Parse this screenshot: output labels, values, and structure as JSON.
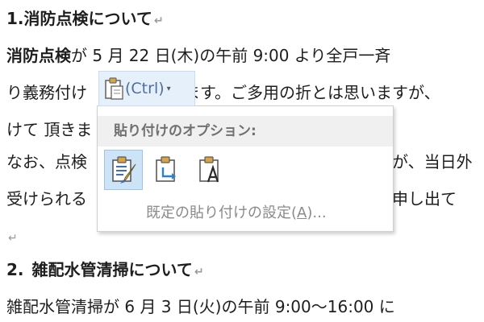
{
  "document": {
    "line1": "1.消防点検について",
    "line2_bold": "消防点検",
    "line2_rest": "が 5 月 22 日(木)の午前 9:00 より全戸一斉",
    "line3_a": "り義務付け",
    "line3_b": "ます。ご多用の折とは思いますが、",
    "line4": "けて 頂きま",
    "line5_a": "なお、点検",
    "line5_b": "が、当日外",
    "line6_a": "受けられる",
    "line6_b": "申し出て",
    "line8_num": "2.",
    "line8_head": "雑配水管清掃について",
    "line9": "雑配水管清掃が 6 月 3 日(火)の午前 9:00〜16:00 に",
    "paragraph_mark": "↵"
  },
  "smart_tag": {
    "label": "(Ctrl)",
    "icon": "clipboard-icon",
    "arrow": "▾"
  },
  "paste_menu": {
    "title": "貼り付けのオプション:",
    "options": [
      {
        "icon": "keep-source-formatting-icon"
      },
      {
        "icon": "merge-formatting-icon"
      },
      {
        "icon": "keep-text-only-icon"
      }
    ],
    "default_prefix": "既定の貼り付けの設定(",
    "default_key": "A",
    "default_suffix": ")..."
  },
  "colors": {
    "accent": "#4d6f9c",
    "selected_bg": "#cde3f7",
    "header_bg": "#f0f0f0",
    "text": "#1e1e1e",
    "muted": "#8a8a8a"
  }
}
